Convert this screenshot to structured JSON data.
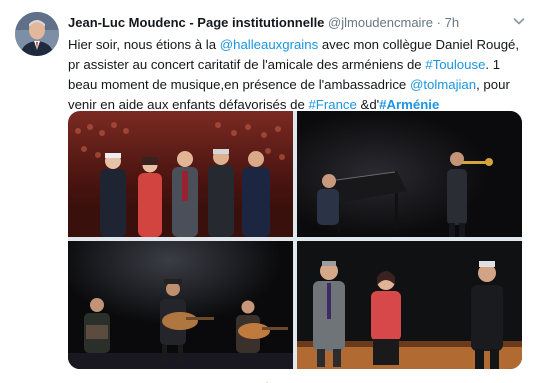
{
  "tweet": {
    "author_name": "Jean-Luc Moudenc - Page institutionnelle",
    "author_handle": "@jlmoudencmaire",
    "separator": "·",
    "time": "7h",
    "text_parts": [
      {
        "text": "Hier soir, nous étions à la ",
        "kind": "plain"
      },
      {
        "text": "@halleauxgrains",
        "kind": "link"
      },
      {
        "text": " avec mon collègue Daniel Rougé, pr assister au concert caritatif de l'amicale des arméniens de ",
        "kind": "plain"
      },
      {
        "text": "#Toulouse",
        "kind": "link"
      },
      {
        "text": ". 1 beau moment de musique,en présence de l'ambassadrice ",
        "kind": "plain"
      },
      {
        "text": "@tolmajian",
        "kind": "link"
      },
      {
        "text": ", pour venir en aide aux enfants défavorisés de ",
        "kind": "plain"
      },
      {
        "text": "#France",
        "kind": "link"
      },
      {
        "text": " &d'",
        "kind": "plain"
      },
      {
        "text": "#Arménie",
        "kind": "bold-link"
      }
    ]
  },
  "icons": {
    "avatar": "profile-photo",
    "menu": "chevron-down-icon"
  },
  "colors": {
    "link": "#1b95e0",
    "secondary_text": "#657786",
    "primary_text": "#14171a"
  }
}
